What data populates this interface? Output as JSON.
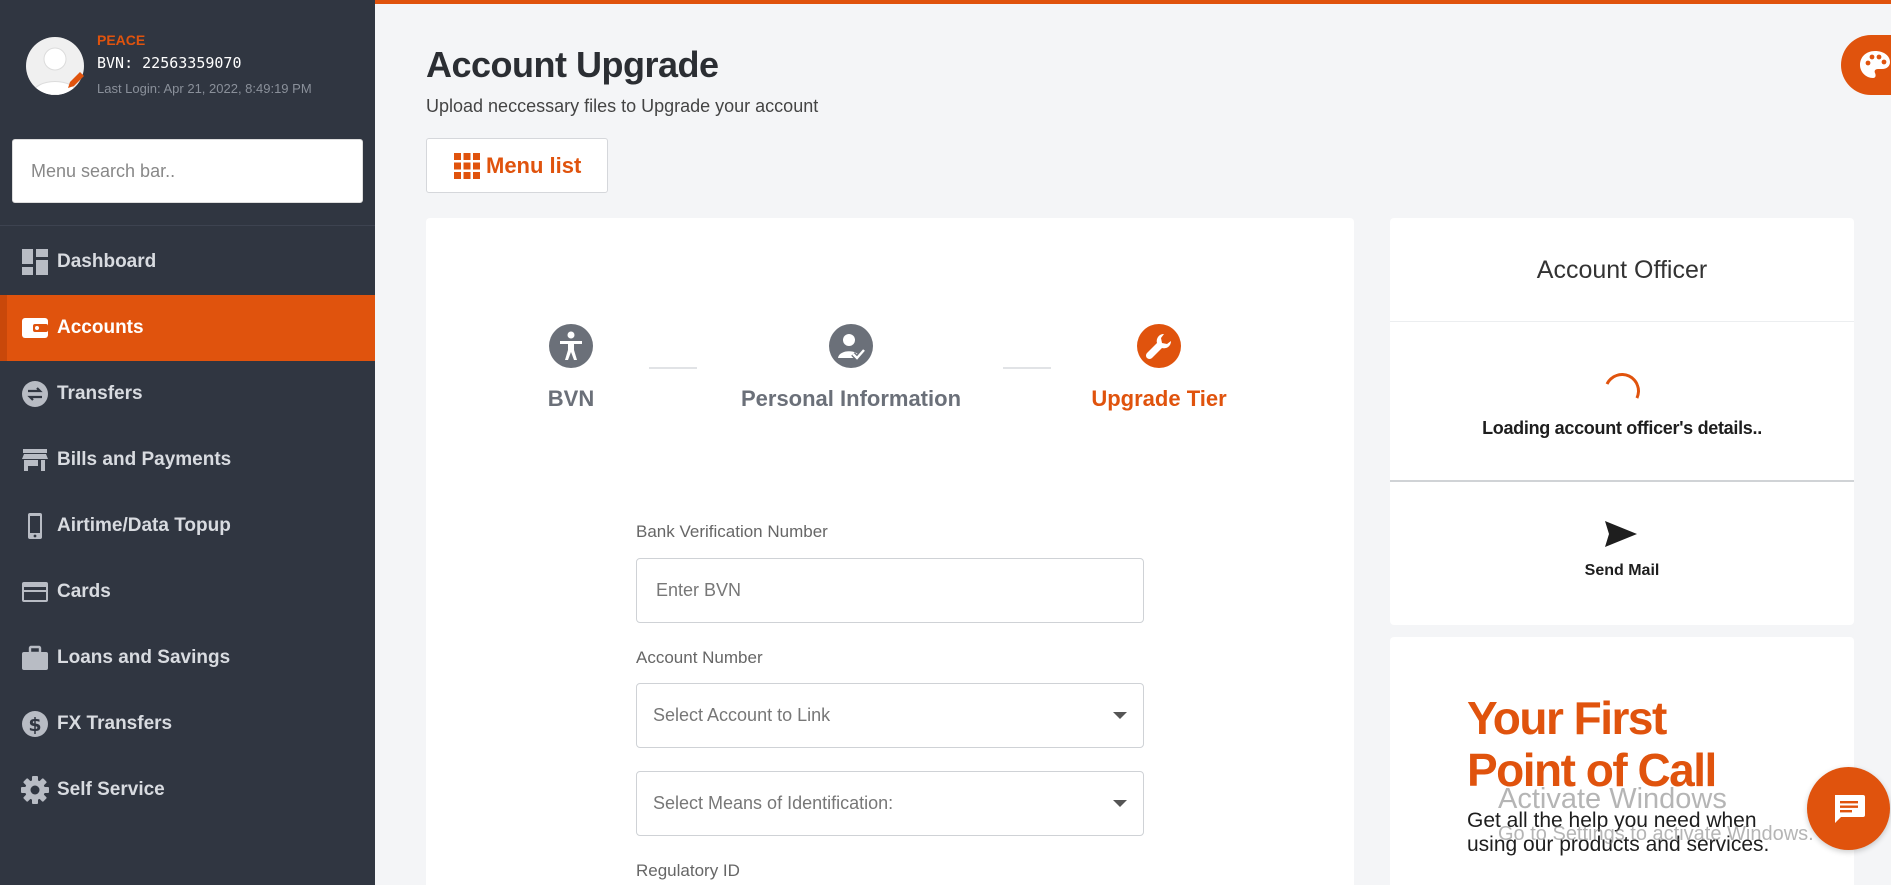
{
  "profile": {
    "name": "PEACE",
    "bvn": "BVN: 22563359070",
    "last_login": "Last Login: Apr 21, 2022, 8:49:19 PM"
  },
  "sidebar": {
    "search_placeholder": "Menu search bar..",
    "items": [
      {
        "label": "Dashboard",
        "icon": "dashboard-icon",
        "active": false
      },
      {
        "label": "Accounts",
        "icon": "wallet-icon",
        "active": true
      },
      {
        "label": "Transfers",
        "icon": "transfer-icon",
        "active": false
      },
      {
        "label": "Bills and Payments",
        "icon": "store-icon",
        "active": false
      },
      {
        "label": "Airtime/Data Topup",
        "icon": "phone-icon",
        "active": false
      },
      {
        "label": "Cards",
        "icon": "card-icon",
        "active": false
      },
      {
        "label": "Loans and Savings",
        "icon": "briefcase-icon",
        "active": false
      },
      {
        "label": "FX Transfers",
        "icon": "dollar-icon",
        "active": false
      },
      {
        "label": "Self Service",
        "icon": "gear-icon",
        "active": false
      }
    ]
  },
  "header": {
    "title": "Account Upgrade",
    "subtitle": "Upload neccessary files to Upgrade your account",
    "menu_list_label": "Menu list"
  },
  "steps": [
    {
      "label": "BVN",
      "icon": "accessibility-icon",
      "state": "done"
    },
    {
      "label": "Personal Information",
      "icon": "user-check-icon",
      "state": "done"
    },
    {
      "label": "Upgrade Tier",
      "icon": "wrench-icon",
      "state": "active"
    }
  ],
  "form": {
    "bvn_label": "Bank Verification Number",
    "bvn_placeholder": "Enter BVN",
    "account_label": "Account Number",
    "account_select": "Select Account to Link",
    "identification_select": "Select Means of Identification:",
    "regulatory_label": "Regulatory ID"
  },
  "officer": {
    "title": "Account Officer",
    "loading": "Loading account officer's details..",
    "send_mail": "Send Mail"
  },
  "promo": {
    "title_line1": "Your First",
    "title_line2": "Point of Call",
    "text_line1": "Get all the help you need when",
    "text_line2": "using our products and services."
  },
  "watermark": {
    "line1": "Activate Windows",
    "line2": "Go to Settings to activate Windows."
  },
  "colors": {
    "accent": "#e0530d",
    "sidebar_bg": "#303641",
    "step_done": "#6b7079"
  }
}
